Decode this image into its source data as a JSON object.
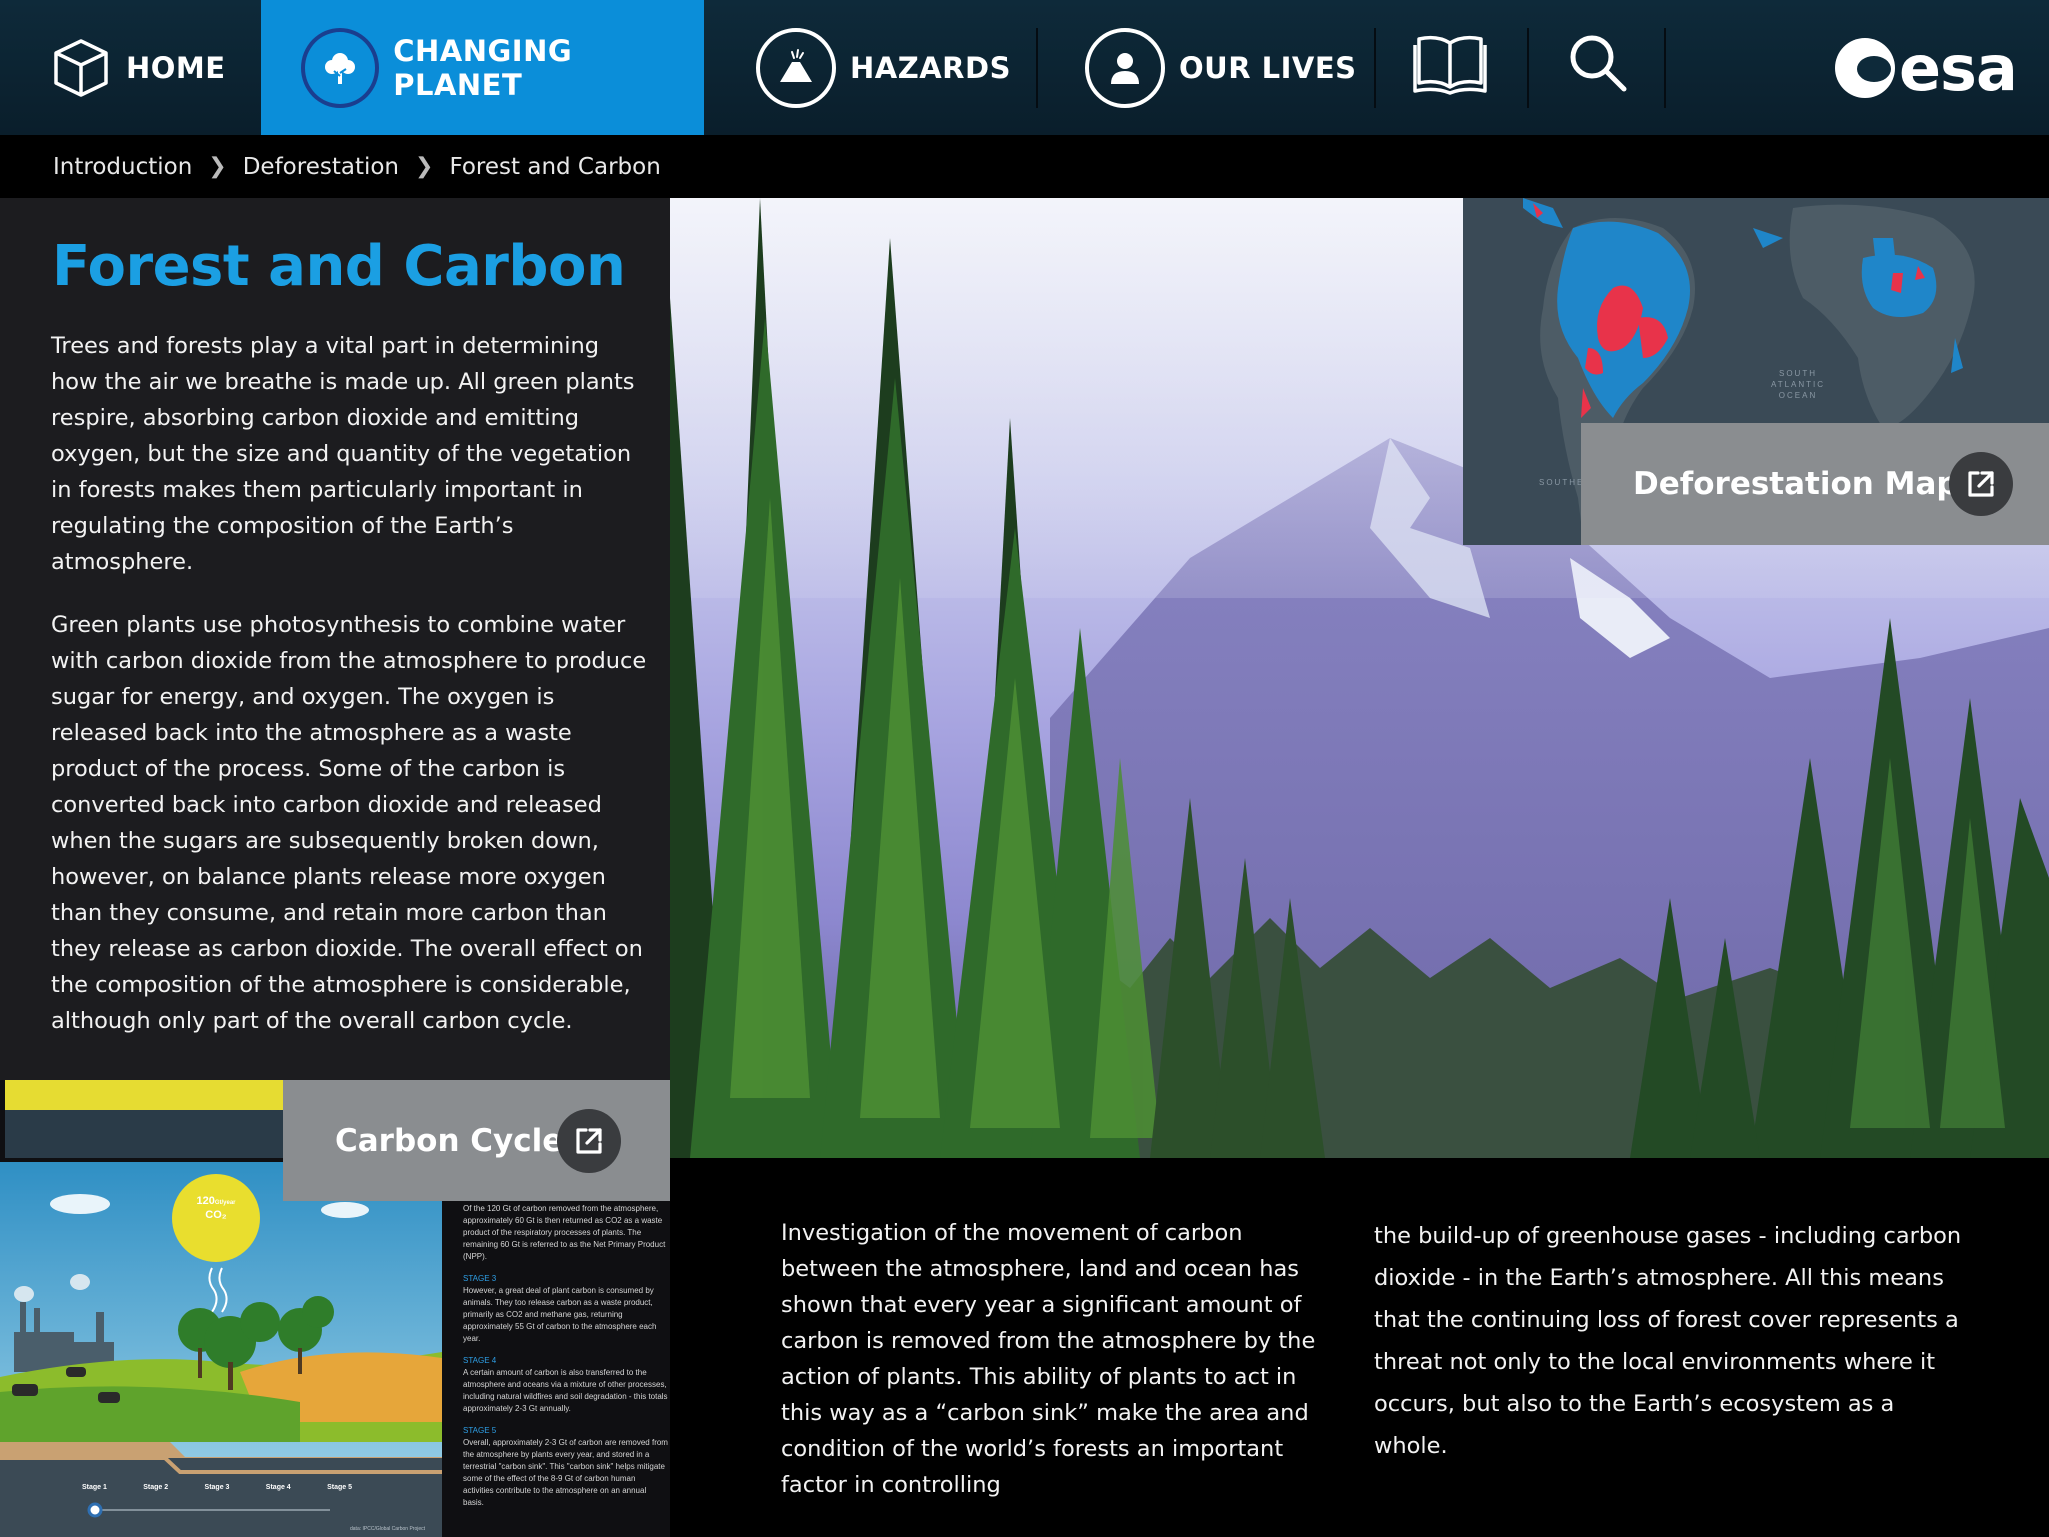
{
  "nav": {
    "home": "HOME",
    "changing_planet": "CHANGING PLANET",
    "hazards": "HAZARDS",
    "our_lives": "OUR LIVES",
    "logo": "esa"
  },
  "breadcrumb": [
    "Introduction",
    "Deforestation",
    "Forest and Carbon"
  ],
  "page": {
    "title": "Forest and Carbon",
    "paragraphs": [
      "Trees and forests play a vital part in determining how the air we breathe is made up. All green plants respire, absorbing carbon dioxide and emitting oxygen, but the size and quantity of the vegetation in forests makes them particularly important in regulating the composition of the Earth’s atmosphere.",
      "Green plants use photosynthesis to combine water with carbon dioxide from the atmosphere to produce sugar for energy, and oxygen. The oxygen is released back into the atmosphere as a waste product of the process. Some of the carbon is converted back into carbon dioxide and released when the sugars are subsequently broken down, however, on balance plants release more oxygen than they consume, and retain more carbon than they release as carbon dioxide. The overall effect on the composition of the atmosphere is considerable, although only part of the overall carbon cycle."
    ]
  },
  "map_card": {
    "label": "Deforestation Map",
    "ocean_label": "SOUTH ATLANTIC OCEAN",
    "partial_label": "SOUTHE"
  },
  "carbon_cycle": {
    "label": "Carbon Cycle",
    "sun_value": "120",
    "sun_unit": "Gt/year",
    "sun_gas": "CO₂",
    "stages": [
      "Stage 1",
      "Stage 2",
      "Stage 3",
      "Stage 4",
      "Stage 5"
    ],
    "source": "data: IPCC/Global Carbon Project",
    "notes": [
      {
        "heading": "",
        "text": "Of the 120 Gt of carbon removed from the atmosphere, approximately 60 Gt is then returned as CO2 as a waste product of the respiratory processes of plants. The remaining 60 Gt is referred to as the Net Primary Product (NPP)."
      },
      {
        "heading": "STAGE 3",
        "text": "However, a great deal of plant carbon is consumed by animals. They too release carbon as a waste product, primarily as CO2 and methane gas, returning approximately 55 Gt of carbon to the atmosphere each year."
      },
      {
        "heading": "STAGE 4",
        "text": "A certain amount of carbon is also transferred to the atmosphere and oceans via a mixture of other processes, including natural wildfires and soil degradation - this totals approximately 2-3 Gt annually."
      },
      {
        "heading": "STAGE 5",
        "text": "Overall, approximately 2-3 Gt of carbon are removed from the atmosphere by plants every year, and stored in a terrestrial \"carbon sink\". This \"carbon sink\" helps mitigate some of the effect of the 8-9 Gt of carbon human activities contribute to the atmosphere on an annual basis."
      }
    ]
  },
  "bottom": {
    "col1": "Investigation of the movement of carbon between the atmosphere, land and ocean has shown that every year a significant amount of carbon is removed from the atmosphere by the action of plants. This ability of plants to act in this way as a “carbon sink” make the area and condition of the world’s forests an important factor in controlling",
    "col2": "the build-up of greenhouse gases - including carbon dioxide - in the Earth’s atmosphere. All this means that the continuing loss of forest cover represents a threat not only to the local environments where it occurs, but also to the Earth’s ecosystem as a whole."
  },
  "colors": {
    "accent": "#0b8ed9",
    "title": "#1b9fe3",
    "panel": "#1c1c1f",
    "link_card": "#8a8d90",
    "deforestation_red": "#e8334a"
  }
}
